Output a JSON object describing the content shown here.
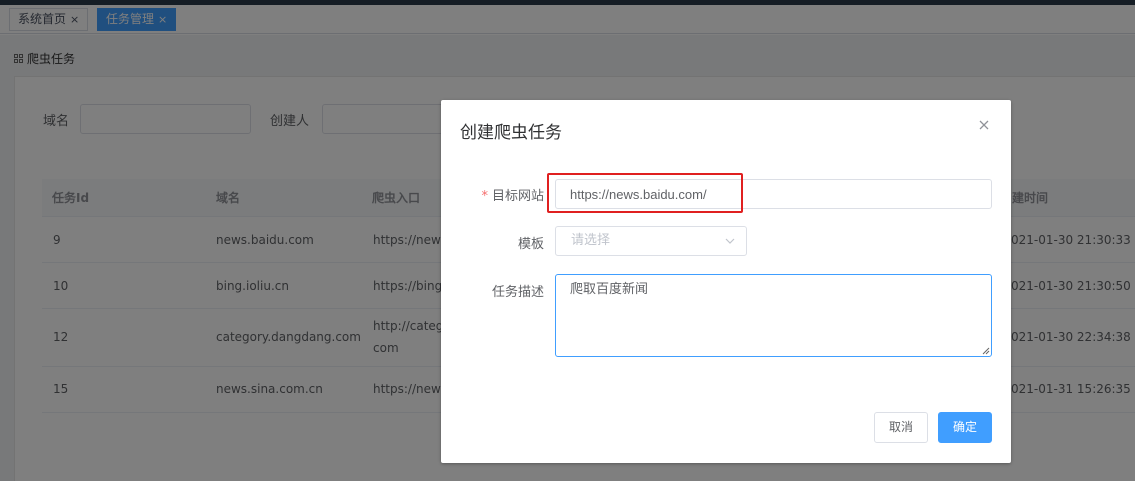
{
  "tabs": [
    {
      "label": "系统首页",
      "close": "×",
      "active": false
    },
    {
      "label": "任务管理",
      "close": "×",
      "active": true
    }
  ],
  "section": {
    "title": "爬虫任务",
    "icon": "grid-icon"
  },
  "filters": {
    "domain_label": "域名",
    "creator_label": "创建人"
  },
  "table": {
    "headers": [
      "任务Id",
      "域名",
      "爬虫入口",
      "建时间"
    ],
    "rows": [
      {
        "id": "9",
        "domain": "news.baidu.com",
        "entry": "https://news.",
        "time": "021-01-30 21:30:33"
      },
      {
        "id": "10",
        "domain": "bing.ioliu.cn",
        "entry": "https://bing.ic",
        "time": "021-01-30 21:30:50"
      },
      {
        "id": "12",
        "domain": "category.dangdang.com",
        "entry": "http://categor",
        "entry2": "com",
        "time": "021-01-30 22:34:38"
      },
      {
        "id": "15",
        "domain": "news.sina.com.cn",
        "entry": "https://news.",
        "time": "021-01-31 15:26:35"
      }
    ]
  },
  "dialog": {
    "title": "创建爬虫任务",
    "required_mark": "*",
    "target_label": "目标网站",
    "target_value": "https://news.baidu.com/",
    "template_label": "模板",
    "template_placeholder": "请选择",
    "desc_label": "任务描述",
    "desc_value": "爬取百度新闻",
    "cancel_label": "取消",
    "ok_label": "确定"
  },
  "colors": {
    "primary": "#409eff",
    "highlight": "#e02020",
    "required": "#f56c6c"
  }
}
